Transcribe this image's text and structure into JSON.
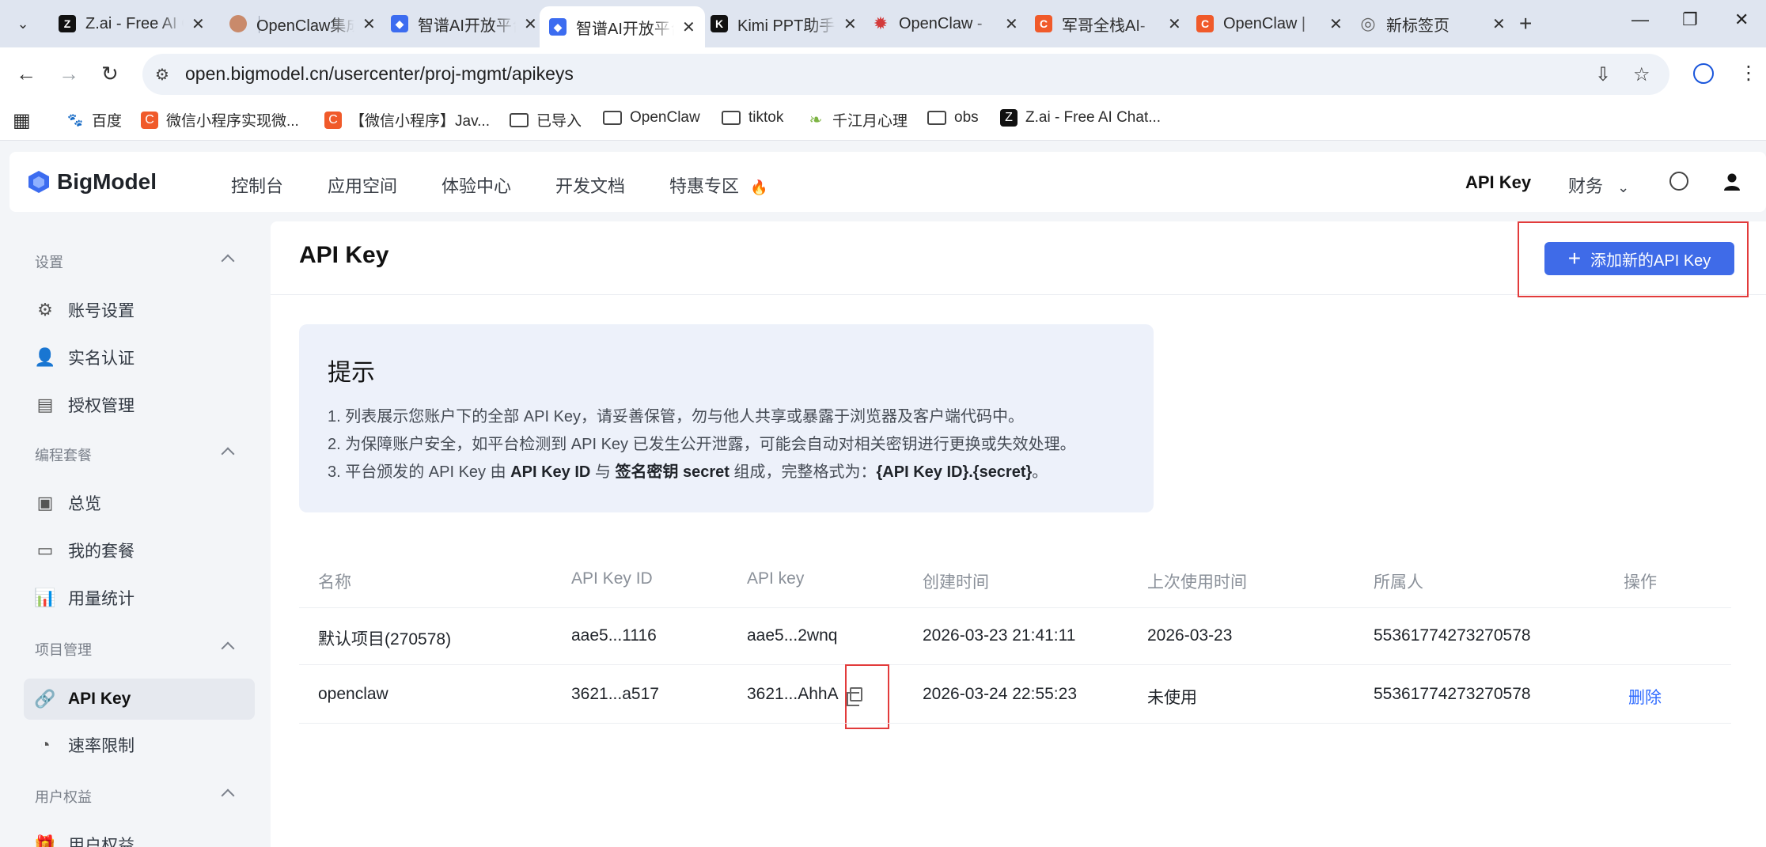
{
  "browser": {
    "tabs": [
      {
        "title": "Z.ai - Free AI Chatbot",
        "favicon": "z-logo",
        "color": "#111111",
        "glyph": "Z"
      },
      {
        "title": "OpenClaw集成",
        "favicon": "avatar",
        "color": "#c98a6b",
        "glyph": ""
      },
      {
        "title": "智谱AI开放平台",
        "favicon": "bigmodel-logo",
        "color": "#3c6cf0",
        "glyph": "◆"
      },
      {
        "title": "智谱AI开放平台",
        "favicon": "bigmodel-logo",
        "color": "#3c6cf0",
        "glyph": "◆",
        "active": true
      },
      {
        "title": "Kimi PPT助手",
        "favicon": "kimi-logo",
        "color": "#111111",
        "glyph": "K"
      },
      {
        "title": "OpenClaw - ",
        "favicon": "claw-logo",
        "color": "#d33a3a",
        "glyph": "✹"
      },
      {
        "title": "军哥全栈AI-",
        "favicon": "csdn-logo",
        "color": "#f05a2a",
        "glyph": "C"
      },
      {
        "title": "OpenClaw | ",
        "favicon": "csdn-logo",
        "color": "#f05a2a",
        "glyph": "C"
      },
      {
        "title": "新标签页",
        "favicon": "chrome-logo",
        "color": "#666666",
        "glyph": "◎"
      }
    ],
    "url": "open.bigmodel.cn/usercenter/proj-mgmt/apikeys",
    "bookmarks": [
      {
        "label": "百度",
        "icon": "baidu-icon",
        "color": "#2f5bd8",
        "glyph": "🐾"
      },
      {
        "label": "微信小程序实现微...",
        "icon": "csdn-icon",
        "color": "#f05a2a",
        "glyph": "C"
      },
      {
        "label": "【微信小程序】Jav...",
        "icon": "csdn-icon",
        "color": "#f05a2a",
        "glyph": "C"
      },
      {
        "label": "已导入",
        "icon": "folder-icon"
      },
      {
        "label": "OpenClaw",
        "icon": "folder-icon"
      },
      {
        "label": "tiktok",
        "icon": "folder-icon"
      },
      {
        "label": "千江月心理",
        "icon": "leaf-icon",
        "color": "#7cb342",
        "glyph": "❧"
      },
      {
        "label": "obs",
        "icon": "folder-icon"
      },
      {
        "label": "Z.ai - Free AI Chat...",
        "icon": "z-icon",
        "color": "#111111",
        "glyph": "Z"
      }
    ]
  },
  "header": {
    "brand": "BigModel",
    "nav": [
      "控制台",
      "应用空间",
      "体验中心",
      "开发文档",
      "特惠专区"
    ],
    "hot_icon": "🔥",
    "api_key_link": "API Key",
    "finance": "财务"
  },
  "sidebar": {
    "sections": [
      {
        "title": "设置",
        "items": [
          "账号设置",
          "实名认证",
          "授权管理"
        ]
      },
      {
        "title": "编程套餐",
        "items": [
          "总览",
          "我的套餐",
          "用量统计"
        ]
      },
      {
        "title": "项目管理",
        "items": [
          "API Key",
          "速率限制"
        ]
      },
      {
        "title": "用户权益",
        "items": [
          "用户权益"
        ]
      }
    ]
  },
  "main": {
    "title": "API Key",
    "add_button": "添加新的API Key",
    "tip": {
      "title": "提示",
      "line1": "1. 列表展示您账户下的全部 API Key，请妥善保管，勿与他人共享或暴露于浏览器及客户端代码中。",
      "line2": "2. 为保障账户安全，如平台检测到 API Key 已发生公开泄露，可能会自动对相关密钥进行更换或失效处理。",
      "line3_a": "3. 平台颁发的 API Key 由 ",
      "line3_b": "API Key ID",
      "line3_c": " 与 ",
      "line3_d": "签名密钥 secret",
      "line3_e": " 组成，完整格式为：",
      "line3_f": "{API Key ID}.{secret}",
      "line3_g": "。"
    },
    "table": {
      "headers": [
        "名称",
        "API Key ID",
        "API key",
        "创建时间",
        "上次使用时间",
        "所属人",
        "操作"
      ],
      "rows": [
        {
          "name": "默认项目(270578)",
          "key_id": "aae5...1116",
          "key": "aae5...2wnq",
          "created": "2026-03-23 21:41:11",
          "last_used": "2026-03-23",
          "owner": "55361774273270578",
          "action": ""
        },
        {
          "name": "openclaw",
          "key_id": "3621...a517",
          "key": "3621...AhhA",
          "created": "2026-03-24 22:55:23",
          "last_used": "未使用",
          "owner": "55361774273270578",
          "action": "删除"
        }
      ]
    }
  },
  "colors": {
    "accent": "#3f6be8",
    "highlight": "#e23b3b",
    "link": "#2f6bff"
  }
}
